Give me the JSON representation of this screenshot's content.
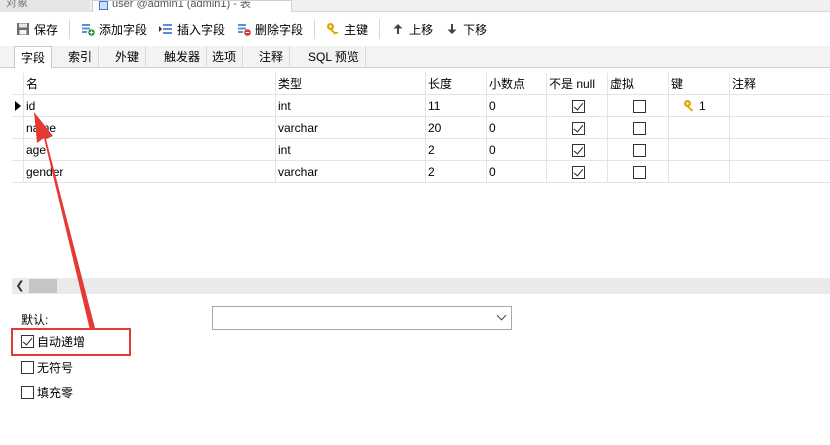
{
  "window": {
    "tabs": [
      {
        "label": "对象"
      },
      {
        "label": "user @admin1 (admin1) - 表"
      }
    ]
  },
  "toolbar": {
    "buttons": [
      {
        "label": "保存",
        "icon": "save-icon"
      },
      {
        "label": "添加字段",
        "icon": "add-field-icon"
      },
      {
        "label": "插入字段",
        "icon": "insert-field-icon"
      },
      {
        "label": "删除字段",
        "icon": "delete-field-icon"
      },
      {
        "label": "主键",
        "icon": "key-icon"
      },
      {
        "label": "上移",
        "icon": "arrow-up-icon"
      },
      {
        "label": "下移",
        "icon": "arrow-down-icon"
      }
    ]
  },
  "subtabs": [
    "字段",
    "索引",
    "外键",
    "触发器",
    "选项",
    "注释",
    "SQL 预览"
  ],
  "grid": {
    "headers": [
      "名",
      "类型",
      "长度",
      "小数点",
      "不是 null",
      "虚拟",
      "键",
      "注释"
    ],
    "rows": [
      {
        "name": "id",
        "type": "int",
        "length": "11",
        "decimals": "0",
        "not_null": true,
        "virtual": false,
        "key": "1",
        "comment": ""
      },
      {
        "name": "name",
        "type": "varchar",
        "length": "20",
        "decimals": "0",
        "not_null": true,
        "virtual": false,
        "key": "",
        "comment": ""
      },
      {
        "name": "age",
        "type": "int",
        "length": "2",
        "decimals": "0",
        "not_null": true,
        "virtual": false,
        "key": "",
        "comment": ""
      },
      {
        "name": "gender",
        "type": "varchar",
        "length": "2",
        "decimals": "0",
        "not_null": true,
        "virtual": false,
        "key": "",
        "comment": ""
      }
    ]
  },
  "props": {
    "default_label": "默认:",
    "default_value": "",
    "auto_increment": {
      "label": "自动递增",
      "checked": true
    },
    "unsigned": {
      "label": "无符号",
      "checked": false
    },
    "zerofill": {
      "label": "填充零",
      "checked": false
    }
  },
  "colors": {
    "annotation": "#e53935",
    "key_gold": "#e0a800"
  }
}
